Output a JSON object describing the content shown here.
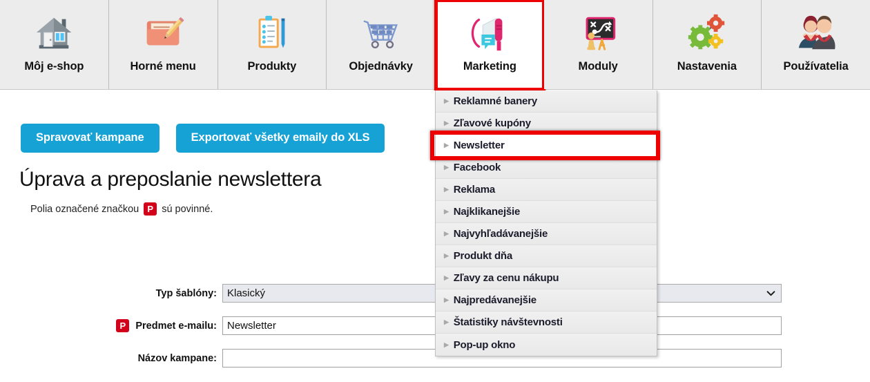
{
  "tabs": [
    {
      "label": "Môj e-shop",
      "icon": "house-icon",
      "selected": false
    },
    {
      "label": "Horné menu",
      "icon": "folder-pencil-icon",
      "selected": false
    },
    {
      "label": "Produkty",
      "icon": "clipboard-checklist-icon",
      "selected": false
    },
    {
      "label": "Objednávky",
      "icon": "shopping-cart-icon",
      "selected": false
    },
    {
      "label": "Marketing",
      "icon": "megaphone-icon",
      "selected": true
    },
    {
      "label": "Moduly",
      "icon": "chalkboard-strategy-icon",
      "selected": false
    },
    {
      "label": "Nastavenia",
      "icon": "gears-icon",
      "selected": false
    },
    {
      "label": "Používatelia",
      "icon": "users-icon",
      "selected": false
    }
  ],
  "menu": {
    "items": [
      {
        "label": "Reklamné banery",
        "active": false
      },
      {
        "label": "Zľavové kupóny",
        "active": false
      },
      {
        "label": "Newsletter",
        "active": true
      },
      {
        "label": "Facebook",
        "active": false
      },
      {
        "label": "Reklama",
        "active": false
      },
      {
        "label": "Najklikanejšie",
        "active": false
      },
      {
        "label": "Najvyhľadávanejšie",
        "active": false
      },
      {
        "label": "Produkt dňa",
        "active": false
      },
      {
        "label": "Zľavy za cenu nákupu",
        "active": false
      },
      {
        "label": "Najpredávanejšie",
        "active": false
      },
      {
        "label": "Štatistiky návštevnosti",
        "active": false
      },
      {
        "label": "Pop-up okno",
        "active": false
      }
    ]
  },
  "content": {
    "buttons": [
      {
        "label": "Spravovať kampane"
      },
      {
        "label": "Exportovať všetky emaily do XLS"
      }
    ],
    "page_title": "Úprava a preposlanie newslettera",
    "required_note_before": "Polia označené značkou",
    "required_badge": "P",
    "required_note_after": "sú povinné."
  },
  "form": {
    "rows": [
      {
        "label": "Typ šablóny:",
        "required": false,
        "type": "select",
        "value": "Klasický",
        "options": [
          "Klasický"
        ]
      },
      {
        "label": "Predmet e-mailu:",
        "required": true,
        "type": "text",
        "value": "Newsletter",
        "placeholder": ""
      },
      {
        "label": "Názov kampane:",
        "required": false,
        "type": "text",
        "value": "",
        "placeholder": ""
      }
    ]
  },
  "colors": {
    "accent_blue": "#17a2d6",
    "highlight_red": "#ee0000",
    "badge_red": "#d2021a",
    "tabbar_bg": "#ececec",
    "menu_bg": "#ededed"
  }
}
